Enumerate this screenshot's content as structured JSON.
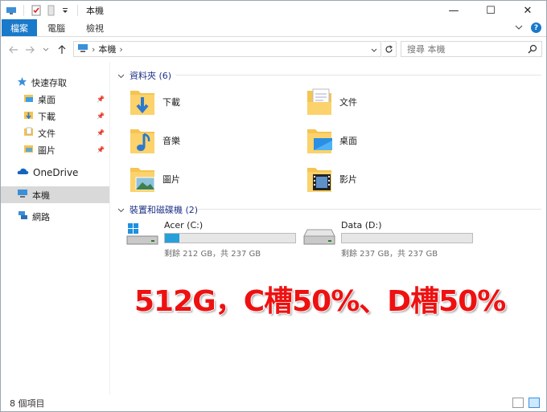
{
  "window": {
    "title": "本機"
  },
  "window_controls": {
    "minimize": "—",
    "maximize": "☐",
    "close": "✕"
  },
  "ribbon": {
    "tabs": [
      "檔案",
      "電腦",
      "檢視"
    ]
  },
  "address": {
    "path": "本機",
    "search_placeholder": "搜尋 本機"
  },
  "sidebar": {
    "quick_access": "快速存取",
    "quick_items": [
      "桌面",
      "下載",
      "文件",
      "圖片"
    ],
    "onedrive": "OneDrive",
    "this_pc": "本機",
    "network": "網路"
  },
  "folders": {
    "header": "資料夾 (6)",
    "items": [
      "下載",
      "文件",
      "音樂",
      "桌面",
      "圖片",
      "影片"
    ]
  },
  "drives": {
    "header": "裝置和磁碟機 (2)",
    "items": [
      {
        "name": "Acer (C:)",
        "free": "剩餘 212 GB，共 237 GB",
        "used_fraction": 0.11
      },
      {
        "name": "Data (D:)",
        "free": "剩餘 237 GB，共 237 GB",
        "used_fraction": 0.0
      }
    ]
  },
  "annotation": "512G，C槽50%、D槽50%",
  "status": {
    "item_count": "8 個項目"
  },
  "colors": {
    "accent": "#1979ca",
    "drive_bar": "#26a0da",
    "annotation": "#ee1111",
    "folder": "#f5c451"
  }
}
